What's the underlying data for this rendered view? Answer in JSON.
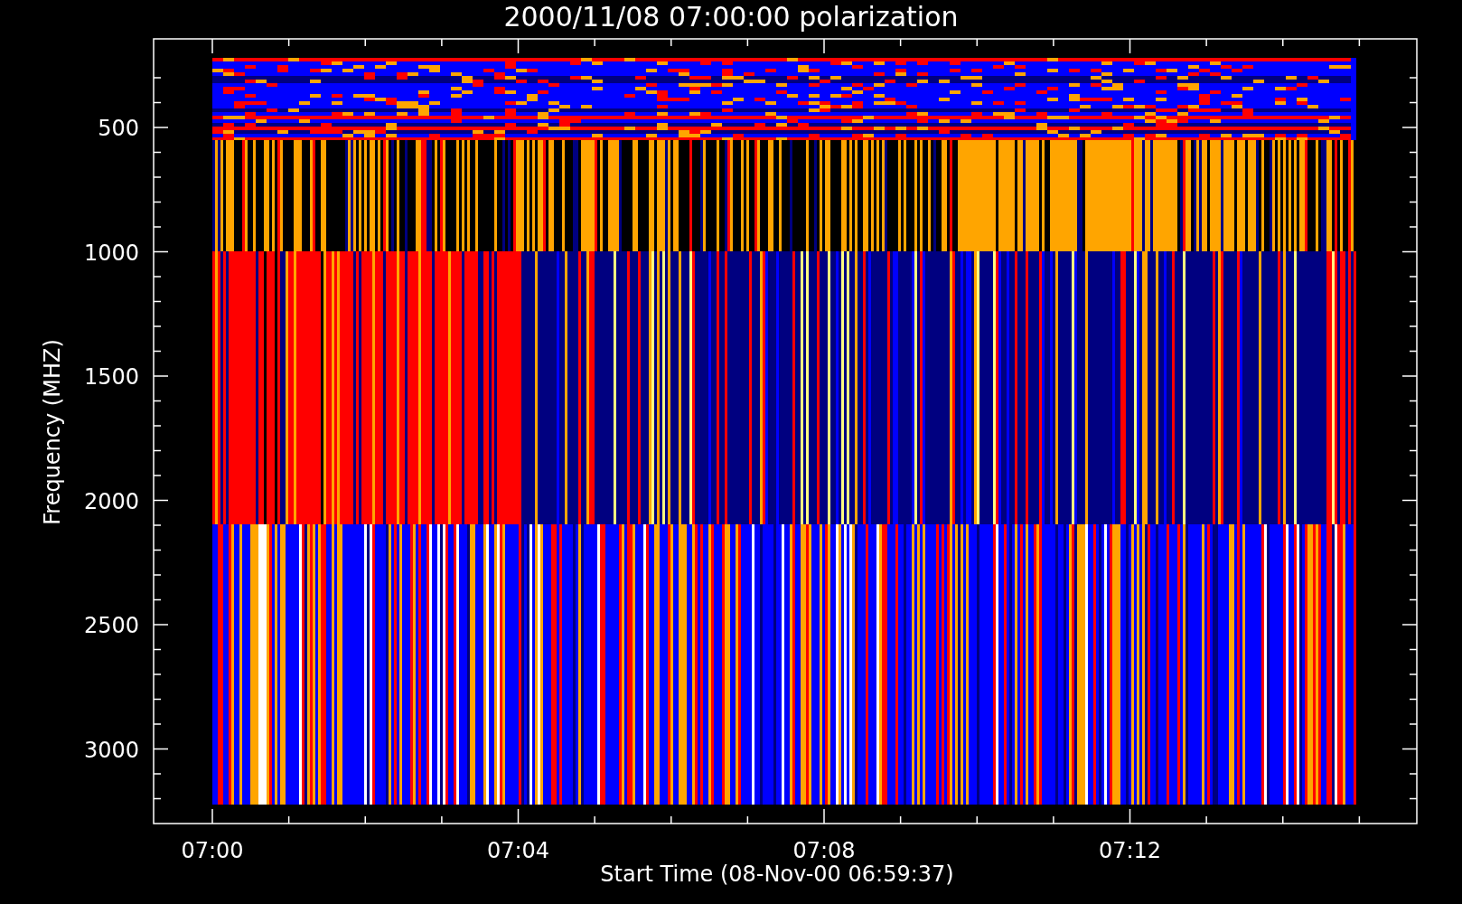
{
  "title": "2000/11/08 07:00:00 polarization",
  "y_axis": {
    "label": "Frequency (MHZ)",
    "ticks": [
      "500",
      "1000",
      "1500",
      "2000",
      "2500",
      "3000"
    ]
  },
  "x_axis": {
    "label": "Start Time (08-Nov-00 06:59:37)",
    "ticks": [
      "07:00",
      "07:04",
      "07:08",
      "07:12"
    ]
  }
}
